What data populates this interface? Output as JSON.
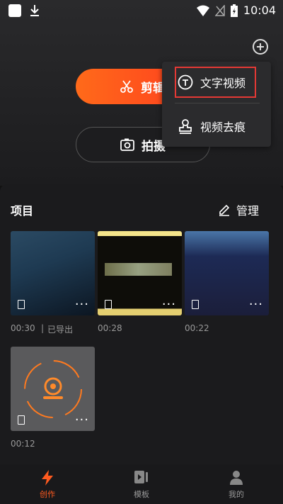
{
  "status": {
    "time": "10:04"
  },
  "top": {
    "edit_label": "剪辑",
    "shoot_label": "拍摄"
  },
  "popup": {
    "text_video": "文字视频",
    "remove_watermark": "视频去痕"
  },
  "project": {
    "title": "项目",
    "manage_label": "管理"
  },
  "items": [
    {
      "duration": "00:30",
      "status": "已导出"
    },
    {
      "duration": "00:28"
    },
    {
      "duration": "00:22"
    },
    {
      "duration": "00:12"
    }
  ],
  "nav": {
    "create": "创作",
    "template": "模板",
    "me": "我的"
  },
  "colors": {
    "accent": "#ff4d1a",
    "highlight": "#e53935"
  }
}
